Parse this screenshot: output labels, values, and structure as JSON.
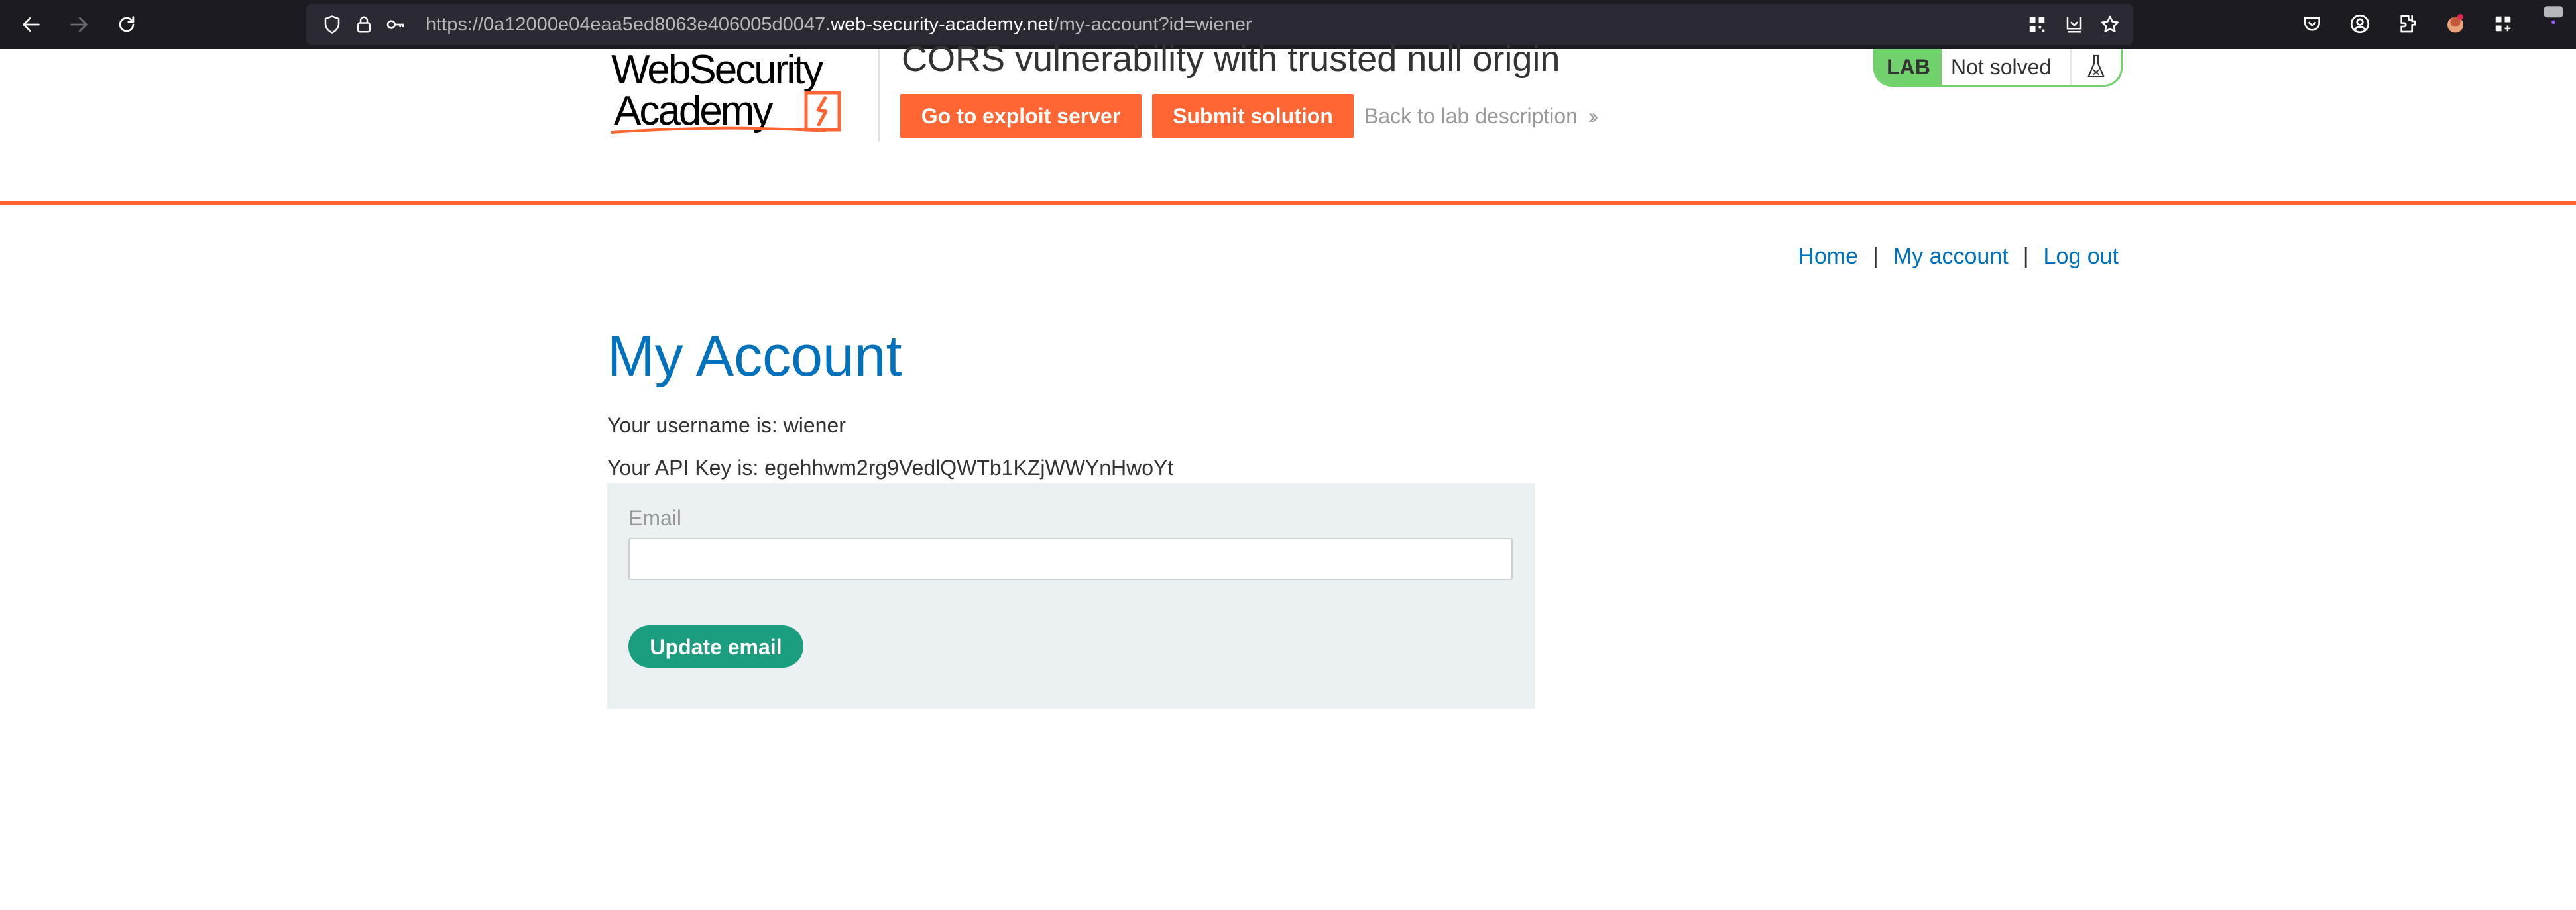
{
  "browser": {
    "url_prefix": "https://0a12000e04eaa5ed8063e406005d0047.",
    "url_domain": "web-security-academy.net",
    "url_path": "/my-account?id=wiener",
    "icons": [
      "back-icon",
      "forward-icon",
      "reload-icon",
      "shield-icon",
      "lock-icon",
      "key-icon",
      "qr-icon",
      "reader-icon",
      "star-icon",
      "pocket-icon",
      "account-icon",
      "extensions-icon",
      "profile-icon",
      "menu-icon"
    ]
  },
  "header": {
    "logo_line1": "WebSecurity",
    "logo_line2": "Academy",
    "lab_title": "CORS vulnerability with trusted null origin",
    "exploit_button": "Go to exploit server",
    "submit_button": "Submit solution",
    "back_link": "Back to lab description",
    "lab_badge": "LAB",
    "lab_status": "Not solved"
  },
  "nav": {
    "home": "Home",
    "my_account": "My account",
    "log_out": "Log out",
    "separator": "|"
  },
  "main": {
    "title": "My Account",
    "username_line": "Your username is: wiener",
    "api_key_line": "Your API Key is: egehhwm2rg9VedlQWTb1KZjWWYnHwoYt",
    "email_label": "Email",
    "email_value": "",
    "update_button": "Update email"
  },
  "colors": {
    "accent_orange": "#ff6633",
    "link_blue": "#0071bc",
    "button_green": "#1a9e7f",
    "status_green": "#70d16d",
    "panel_bg": "#ebf0f2"
  }
}
